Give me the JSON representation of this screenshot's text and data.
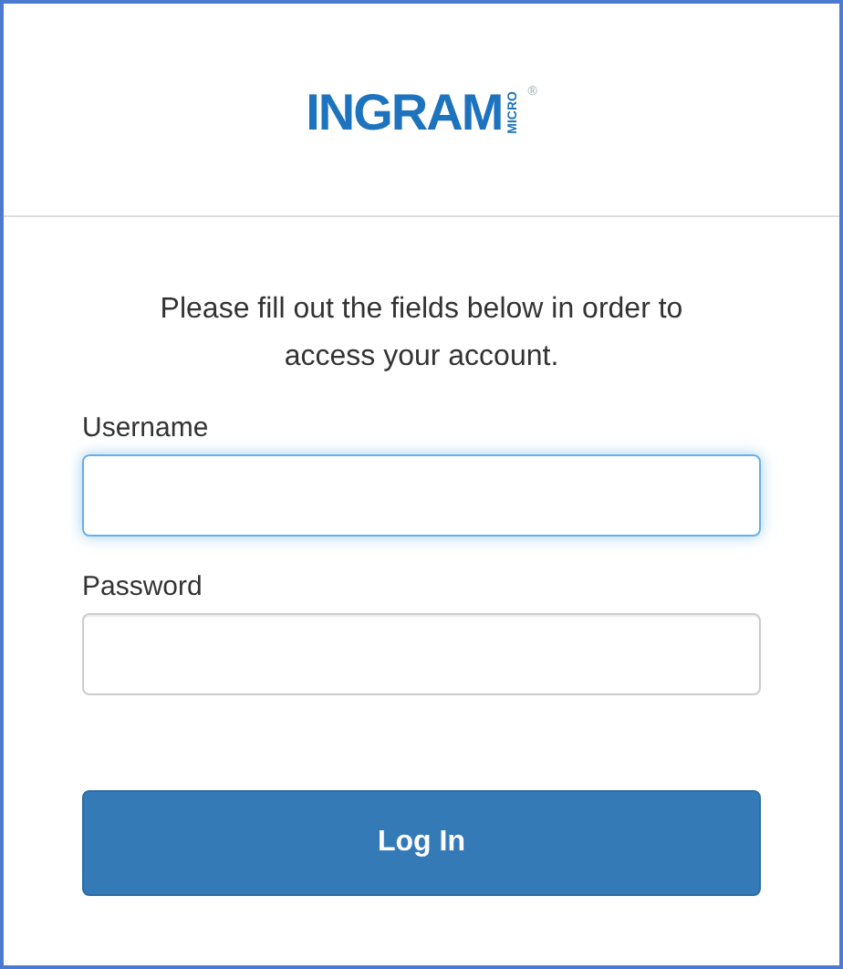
{
  "logo": {
    "name": "INGRAM",
    "sub": "MICRO",
    "mark": "®"
  },
  "intro": "Please fill out the fields below in order to access your account.",
  "fields": [
    {
      "label": "Username",
      "focused": true
    },
    {
      "label": "Password",
      "focused": false
    }
  ],
  "button": "Log In"
}
